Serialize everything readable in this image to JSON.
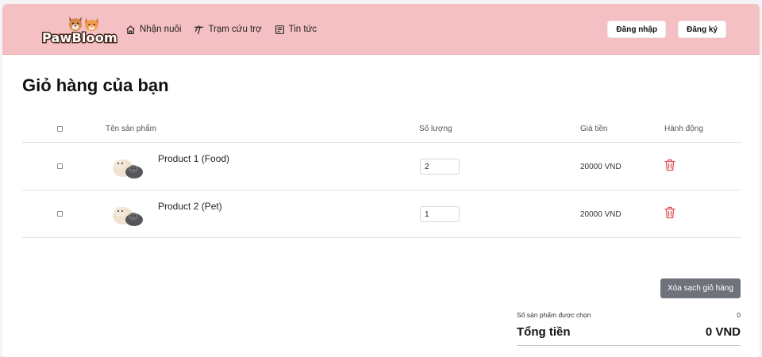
{
  "brand": {
    "logo_text": "PawBloom"
  },
  "nav": [
    {
      "label": "Nhận nuôi",
      "icon": "home-icon"
    },
    {
      "label": "Trạm cứu trợ",
      "icon": "rescue-icon"
    },
    {
      "label": "Tin tức",
      "icon": "news-icon"
    }
  ],
  "auth": {
    "login_label": "Đăng nhập",
    "register_label": "Đăng ký"
  },
  "page": {
    "title": "Giỏ hàng của bạn"
  },
  "table": {
    "headers": {
      "name": "Tên sản phẩm",
      "qty": "Số lượng",
      "price": "Giá tiền",
      "action": "Hành động"
    },
    "rows": [
      {
        "name": "Product 1 (Food)",
        "qty": "2",
        "price": "20000 VND"
      },
      {
        "name": "Product 2 (Pet)",
        "qty": "1",
        "price": "20000 VND"
      }
    ]
  },
  "actions": {
    "clear_label": "Xóa sạch giỏ hàng"
  },
  "summary": {
    "selected_label": "Số sản phẩm được chọn",
    "selected_count": "0",
    "total_label": "Tổng tiền",
    "total_value": "0 VND"
  },
  "colors": {
    "header_bg": "#f4c0c3",
    "trash": "#e05454",
    "clear_button": "#6e737b"
  }
}
